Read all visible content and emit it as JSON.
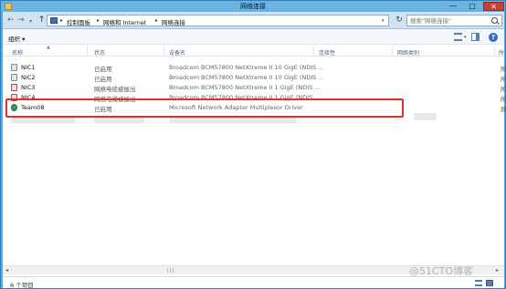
{
  "window": {
    "title": "网络连接",
    "min_glyph": "—",
    "max_glyph": "□",
    "close_glyph": "✕"
  },
  "nav": {
    "back_glyph": "←",
    "forward_glyph": "→",
    "up_glyph": "↑",
    "dropdown_glyph": "▾",
    "refresh_glyph": "↻"
  },
  "breadcrumb": [
    {
      "label": "控制面板"
    },
    {
      "label": "网络和 Internet"
    },
    {
      "label": "网络连接"
    }
  ],
  "breadcrumb_separator": "▸",
  "search": {
    "placeholder": "搜索\"网络连接\""
  },
  "toolbar": {
    "organize_label": "组织 ▾",
    "help_glyph": "?"
  },
  "columns": [
    {
      "label": "名称"
    },
    {
      "label": "状态"
    },
    {
      "label": "设备名"
    },
    {
      "label": "连接性"
    },
    {
      "label": "网络类别"
    },
    {
      "label": "所"
    }
  ],
  "sort_glyph": "▲",
  "rows": [
    {
      "name": "NIC1",
      "status": "已启用",
      "device": "Broadcom BCM57800 NetXtreme II 10 GigE (NDIS ...",
      "cut": "所",
      "icon": "network-adapter-icon"
    },
    {
      "name": "NIC2",
      "status": "已启用",
      "device": "Broadcom BCM57800 NetXtreme II 10 GigE (NDIS ...",
      "cut": "所",
      "icon": "network-adapter-icon"
    },
    {
      "name": "NIC3",
      "status": "网络电缆被拔出",
      "device": "Broadcom BCM57800 NetXtreme II 1 GigE (NDIS ...",
      "cut": "所",
      "icon": "network-cable-unplugged-icon"
    },
    {
      "name": "NIC4",
      "status": "网络电缆被拔出",
      "device": "Broadcom BCM57800 NetXtreme II 1 GigE (NDIS ...",
      "cut": "所",
      "icon": "network-cable-unplugged-icon"
    },
    {
      "name": "Team08",
      "status": "已启用",
      "device": "Microsoft Network Adapter Multiplexor Driver",
      "cut": "屏",
      "icon": "team-adapter-icon"
    }
  ],
  "scrollbar": {
    "left_glyph": "◂",
    "right_glyph": "▸",
    "grip_glyph": "|||"
  },
  "status": {
    "item_count": "6 个项目"
  },
  "watermark": "@51CTO博客"
}
